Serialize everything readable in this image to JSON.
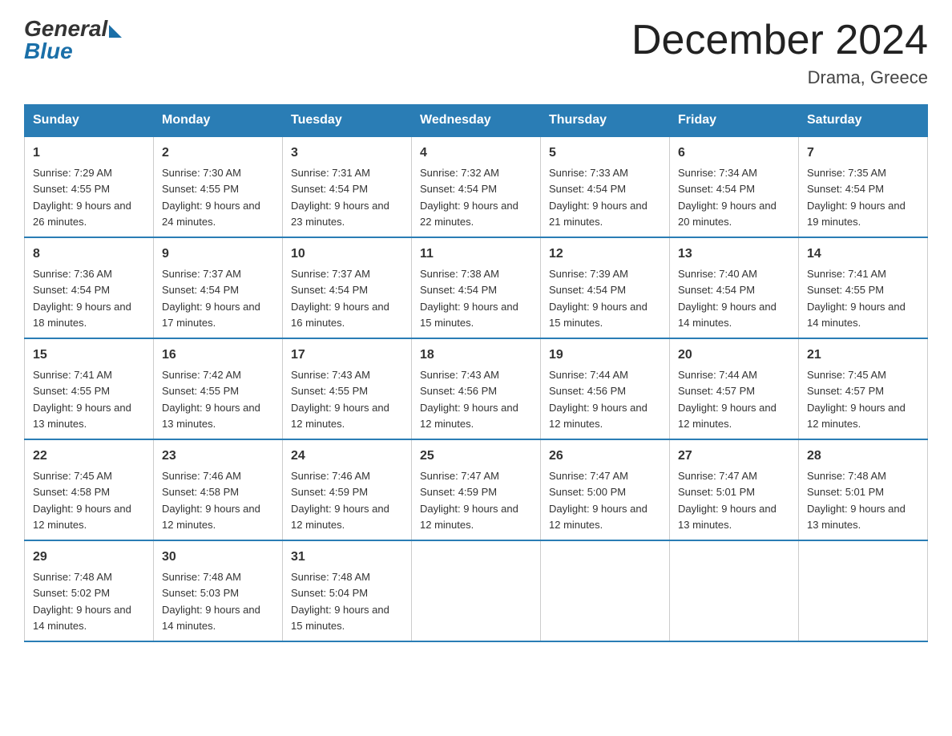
{
  "logo": {
    "general": "General",
    "blue": "Blue"
  },
  "title": "December 2024",
  "location": "Drama, Greece",
  "days_header": [
    "Sunday",
    "Monday",
    "Tuesday",
    "Wednesday",
    "Thursday",
    "Friday",
    "Saturday"
  ],
  "weeks": [
    [
      {
        "num": "1",
        "sunrise": "7:29 AM",
        "sunset": "4:55 PM",
        "daylight": "9 hours and 26 minutes."
      },
      {
        "num": "2",
        "sunrise": "7:30 AM",
        "sunset": "4:55 PM",
        "daylight": "9 hours and 24 minutes."
      },
      {
        "num": "3",
        "sunrise": "7:31 AM",
        "sunset": "4:54 PM",
        "daylight": "9 hours and 23 minutes."
      },
      {
        "num": "4",
        "sunrise": "7:32 AM",
        "sunset": "4:54 PM",
        "daylight": "9 hours and 22 minutes."
      },
      {
        "num": "5",
        "sunrise": "7:33 AM",
        "sunset": "4:54 PM",
        "daylight": "9 hours and 21 minutes."
      },
      {
        "num": "6",
        "sunrise": "7:34 AM",
        "sunset": "4:54 PM",
        "daylight": "9 hours and 20 minutes."
      },
      {
        "num": "7",
        "sunrise": "7:35 AM",
        "sunset": "4:54 PM",
        "daylight": "9 hours and 19 minutes."
      }
    ],
    [
      {
        "num": "8",
        "sunrise": "7:36 AM",
        "sunset": "4:54 PM",
        "daylight": "9 hours and 18 minutes."
      },
      {
        "num": "9",
        "sunrise": "7:37 AM",
        "sunset": "4:54 PM",
        "daylight": "9 hours and 17 minutes."
      },
      {
        "num": "10",
        "sunrise": "7:37 AM",
        "sunset": "4:54 PM",
        "daylight": "9 hours and 16 minutes."
      },
      {
        "num": "11",
        "sunrise": "7:38 AM",
        "sunset": "4:54 PM",
        "daylight": "9 hours and 15 minutes."
      },
      {
        "num": "12",
        "sunrise": "7:39 AM",
        "sunset": "4:54 PM",
        "daylight": "9 hours and 15 minutes."
      },
      {
        "num": "13",
        "sunrise": "7:40 AM",
        "sunset": "4:54 PM",
        "daylight": "9 hours and 14 minutes."
      },
      {
        "num": "14",
        "sunrise": "7:41 AM",
        "sunset": "4:55 PM",
        "daylight": "9 hours and 14 minutes."
      }
    ],
    [
      {
        "num": "15",
        "sunrise": "7:41 AM",
        "sunset": "4:55 PM",
        "daylight": "9 hours and 13 minutes."
      },
      {
        "num": "16",
        "sunrise": "7:42 AM",
        "sunset": "4:55 PM",
        "daylight": "9 hours and 13 minutes."
      },
      {
        "num": "17",
        "sunrise": "7:43 AM",
        "sunset": "4:55 PM",
        "daylight": "9 hours and 12 minutes."
      },
      {
        "num": "18",
        "sunrise": "7:43 AM",
        "sunset": "4:56 PM",
        "daylight": "9 hours and 12 minutes."
      },
      {
        "num": "19",
        "sunrise": "7:44 AM",
        "sunset": "4:56 PM",
        "daylight": "9 hours and 12 minutes."
      },
      {
        "num": "20",
        "sunrise": "7:44 AM",
        "sunset": "4:57 PM",
        "daylight": "9 hours and 12 minutes."
      },
      {
        "num": "21",
        "sunrise": "7:45 AM",
        "sunset": "4:57 PM",
        "daylight": "9 hours and 12 minutes."
      }
    ],
    [
      {
        "num": "22",
        "sunrise": "7:45 AM",
        "sunset": "4:58 PM",
        "daylight": "9 hours and 12 minutes."
      },
      {
        "num": "23",
        "sunrise": "7:46 AM",
        "sunset": "4:58 PM",
        "daylight": "9 hours and 12 minutes."
      },
      {
        "num": "24",
        "sunrise": "7:46 AM",
        "sunset": "4:59 PM",
        "daylight": "9 hours and 12 minutes."
      },
      {
        "num": "25",
        "sunrise": "7:47 AM",
        "sunset": "4:59 PM",
        "daylight": "9 hours and 12 minutes."
      },
      {
        "num": "26",
        "sunrise": "7:47 AM",
        "sunset": "5:00 PM",
        "daylight": "9 hours and 12 minutes."
      },
      {
        "num": "27",
        "sunrise": "7:47 AM",
        "sunset": "5:01 PM",
        "daylight": "9 hours and 13 minutes."
      },
      {
        "num": "28",
        "sunrise": "7:48 AM",
        "sunset": "5:01 PM",
        "daylight": "9 hours and 13 minutes."
      }
    ],
    [
      {
        "num": "29",
        "sunrise": "7:48 AM",
        "sunset": "5:02 PM",
        "daylight": "9 hours and 14 minutes."
      },
      {
        "num": "30",
        "sunrise": "7:48 AM",
        "sunset": "5:03 PM",
        "daylight": "9 hours and 14 minutes."
      },
      {
        "num": "31",
        "sunrise": "7:48 AM",
        "sunset": "5:04 PM",
        "daylight": "9 hours and 15 minutes."
      },
      null,
      null,
      null,
      null
    ]
  ],
  "labels": {
    "sunrise_prefix": "Sunrise: ",
    "sunset_prefix": "Sunset: ",
    "daylight_prefix": "Daylight: "
  }
}
